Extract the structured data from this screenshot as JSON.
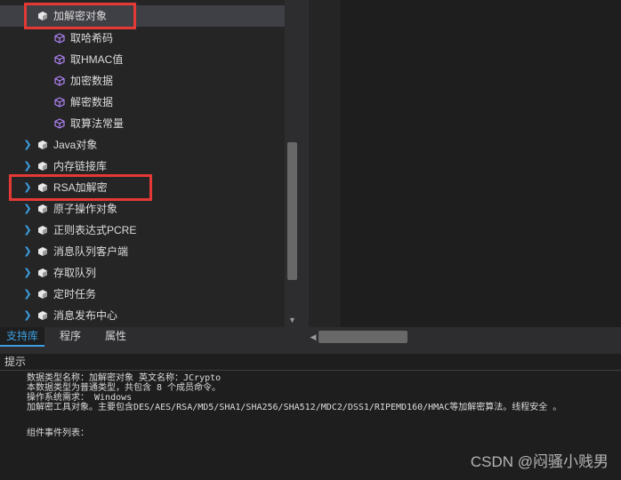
{
  "tree": {
    "items": [
      {
        "label": "加解密对象",
        "icon": "cube-white-icon",
        "selected": true
      },
      {
        "label": "取哈希码",
        "icon": "cube-purple-icon"
      },
      {
        "label": "取HMAC值",
        "icon": "cube-purple-icon"
      },
      {
        "label": "加密数据",
        "icon": "cube-purple-icon"
      },
      {
        "label": "解密数据",
        "icon": "cube-purple-icon"
      },
      {
        "label": "取算法常量",
        "icon": "cube-purple-icon"
      },
      {
        "label": "Java对象",
        "icon": "cube-white-icon",
        "expandable": true
      },
      {
        "label": "内存链接库",
        "icon": "cube-white-icon",
        "expandable": true
      },
      {
        "label": "RSA加解密",
        "icon": "cube-white-icon",
        "expandable": true
      },
      {
        "label": "原子操作对象",
        "icon": "cube-white-icon",
        "expandable": true
      },
      {
        "label": "正则表达式PCRE",
        "icon": "cube-white-icon",
        "expandable": true
      },
      {
        "label": "消息队列客户端",
        "icon": "cube-white-icon",
        "expandable": true
      },
      {
        "label": "存取队列",
        "icon": "cube-white-icon",
        "expandable": true
      },
      {
        "label": "定时任务",
        "icon": "cube-white-icon",
        "expandable": true
      },
      {
        "label": "消息发布中心",
        "icon": "cube-white-icon",
        "expandable": true
      }
    ]
  },
  "tabs": [
    {
      "label": "支持库",
      "active": true
    },
    {
      "label": "程序"
    },
    {
      "label": "属性"
    }
  ],
  "hint": {
    "title": "提示",
    "lines": [
      "数据类型名称：加解密对象    英文名称：JCrypto",
      "本数据类型为普通类型，共包含 8 个成员命令。",
      "操作系统需求： Windows",
      "加解密工具对象。主要包含DES/AES/RSA/MD5/SHA1/SHA256/SHA512/MDC2/DSS1/RIPEMD160/HMAC等加解密算法。线程安全 。",
      "组件事件列表："
    ]
  },
  "watermark": "CSDN @闷骚小贱男",
  "colors": {
    "accent": "#3c9fe0",
    "highlight_box": "#e53935",
    "method_icon": "#b084f5"
  }
}
